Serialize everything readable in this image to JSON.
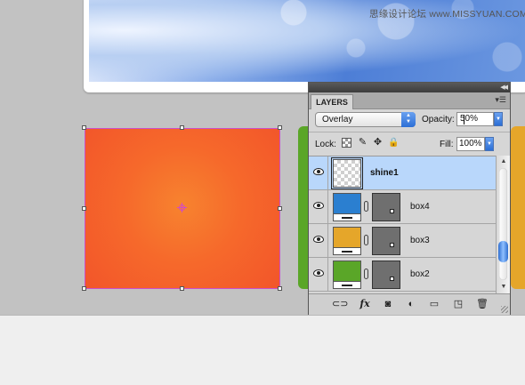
{
  "watermark": "思缘设计论坛 www.MISSYUAN.COM",
  "layers_panel": {
    "tab_label": "LAYERS",
    "blend_mode": "Overlay",
    "opacity_label": "Opacity:",
    "opacity_value": "50%",
    "lock_label": "Lock:",
    "fill_label": "Fill:",
    "fill_value": "100%",
    "layers": [
      {
        "name": "shine1",
        "selected": true
      },
      {
        "name": "box4",
        "color": "#2b7fd0"
      },
      {
        "name": "box3",
        "color": "#e5a62a"
      },
      {
        "name": "box2",
        "color": "#5aa628"
      }
    ],
    "bottom_icons": [
      "link-icon",
      "fx-icon",
      "mask-icon",
      "adjustment-icon",
      "group-folder-icon",
      "new-layer-icon",
      "trash-icon"
    ],
    "fx_text": "fx"
  },
  "canvas": {
    "selected_shape_color": "#f6692b",
    "side_strip_left_color": "#5aa628",
    "side_strip_right_color": "#e5a62a"
  }
}
